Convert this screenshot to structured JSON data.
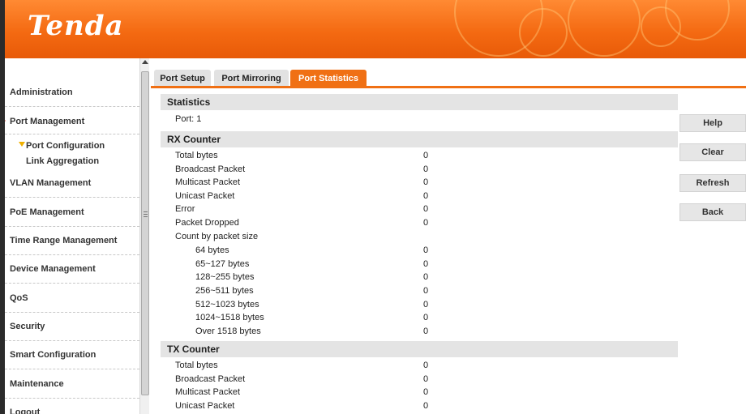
{
  "header": {
    "logo": "Tenda"
  },
  "sidebar": {
    "items": [
      {
        "label": "Administration"
      },
      {
        "label": "Port Management"
      },
      {
        "label": "VLAN Management"
      },
      {
        "label": "PoE Management"
      },
      {
        "label": "Time Range Management"
      },
      {
        "label": "Device Management"
      },
      {
        "label": "QoS"
      },
      {
        "label": "Security"
      },
      {
        "label": "Smart Configuration"
      },
      {
        "label": "Maintenance"
      },
      {
        "label": "Logout"
      }
    ],
    "sub_items": [
      {
        "label": "Port Configuration"
      },
      {
        "label": "Link Aggregation"
      }
    ]
  },
  "tabs": [
    {
      "label": "Port Setup"
    },
    {
      "label": "Port Mirroring"
    },
    {
      "label": "Port Statistics"
    }
  ],
  "statistics": {
    "title": "Statistics",
    "port": "Port: 1"
  },
  "rx": {
    "title": "RX Counter",
    "rows": [
      {
        "label": "Total bytes",
        "value": "0"
      },
      {
        "label": "Broadcast Packet",
        "value": "0"
      },
      {
        "label": "Multicast Packet",
        "value": "0"
      },
      {
        "label": "Unicast Packet",
        "value": "0"
      },
      {
        "label": "Error",
        "value": "0"
      },
      {
        "label": "Packet Dropped",
        "value": "0"
      }
    ],
    "count_label": "Count by packet size",
    "sizes": [
      {
        "label": "64 bytes",
        "value": "0"
      },
      {
        "label": "65~127 bytes",
        "value": "0"
      },
      {
        "label": "128~255 bytes",
        "value": "0"
      },
      {
        "label": "256~511 bytes",
        "value": "0"
      },
      {
        "label": "512~1023 bytes",
        "value": "0"
      },
      {
        "label": "1024~1518 bytes",
        "value": "0"
      },
      {
        "label": "Over 1518 bytes",
        "value": "0"
      }
    ]
  },
  "tx": {
    "title": "TX Counter",
    "rows": [
      {
        "label": "Total bytes",
        "value": "0"
      },
      {
        "label": "Broadcast Packet",
        "value": "0"
      },
      {
        "label": "Multicast Packet",
        "value": "0"
      },
      {
        "label": "Unicast Packet",
        "value": "0"
      }
    ]
  },
  "buttons": {
    "help": "Help",
    "clear": "Clear",
    "refresh": "Refresh",
    "back": "Back"
  },
  "colors": {
    "accent": "#f07014",
    "header": "#f46a12",
    "marker": "#e83010"
  }
}
